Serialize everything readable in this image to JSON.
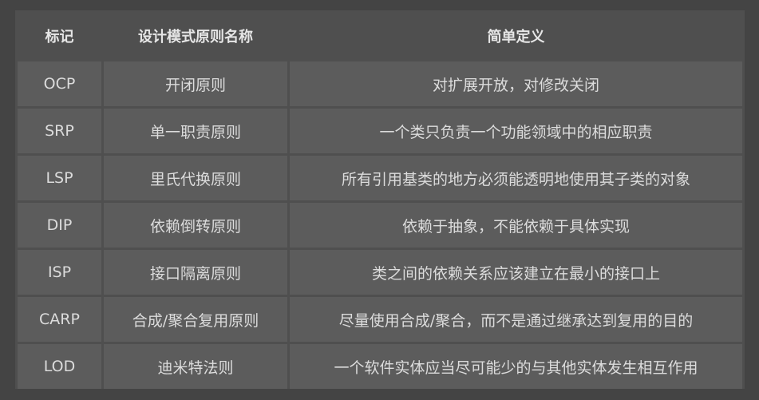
{
  "table": {
    "headers": [
      "标记",
      "设计模式原则名称",
      "简单定义"
    ],
    "rows": [
      {
        "code": "OCP",
        "name": "开闭原则",
        "definition": "对扩展开放，对修改关闭"
      },
      {
        "code": "SRP",
        "name": "单一职责原则",
        "definition": "一个类只负责一个功能领域中的相应职责"
      },
      {
        "code": "LSP",
        "name": "里氏代换原则",
        "definition": "所有引用基类的地方必须能透明地使用其子类的对象"
      },
      {
        "code": "DIP",
        "name": "依赖倒转原则",
        "definition": "依赖于抽象，不能依赖于具体实现"
      },
      {
        "code": "ISP",
        "name": "接口隔离原则",
        "definition": "类之间的依赖关系应该建立在最小的接口上"
      },
      {
        "code": "CARP",
        "name": "合成/聚合复用原则",
        "definition": "尽量使用合成/聚合，而不是通过继承达到复用的目的"
      },
      {
        "code": "LOD",
        "name": "迪米特法则",
        "definition": "一个软件实体应当尽可能少的与其他实体发生相互作用"
      }
    ]
  }
}
